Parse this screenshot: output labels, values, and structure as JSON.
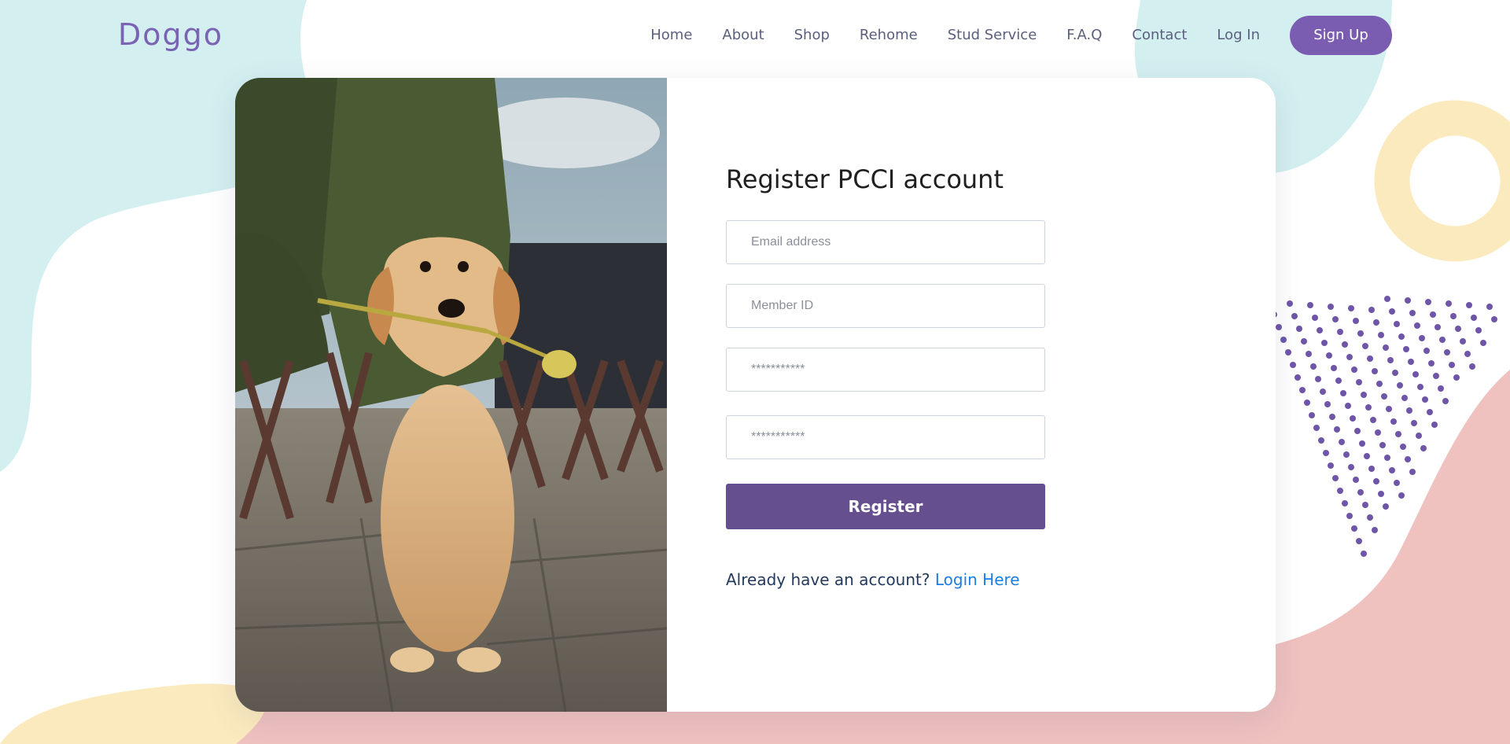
{
  "brand": {
    "name": "Doggo"
  },
  "nav": {
    "items": [
      "Home",
      "About",
      "Shop",
      "Rehome",
      "Stud Service",
      "F.A.Q",
      "Contact",
      "Log In"
    ],
    "signup_label": "Sign Up"
  },
  "register": {
    "title": "Register PCCI account",
    "email_placeholder": "Email address",
    "member_id_placeholder": "Member ID",
    "password_placeholder": "***********",
    "confirm_password_placeholder": "***********",
    "submit_label": "Register",
    "already_text": "Already have an account?",
    "login_link": "Login Here"
  },
  "colors": {
    "brand_purple": "#7a5cb0",
    "button_purple": "#654f8f",
    "link_blue": "#1a7ee6",
    "blob_teal": "#d3eff0",
    "blob_pink": "#efc1bf",
    "blob_cream": "#fbeabd"
  },
  "photo": {
    "subject": "golden retriever puppy holding a yellow tulip"
  }
}
